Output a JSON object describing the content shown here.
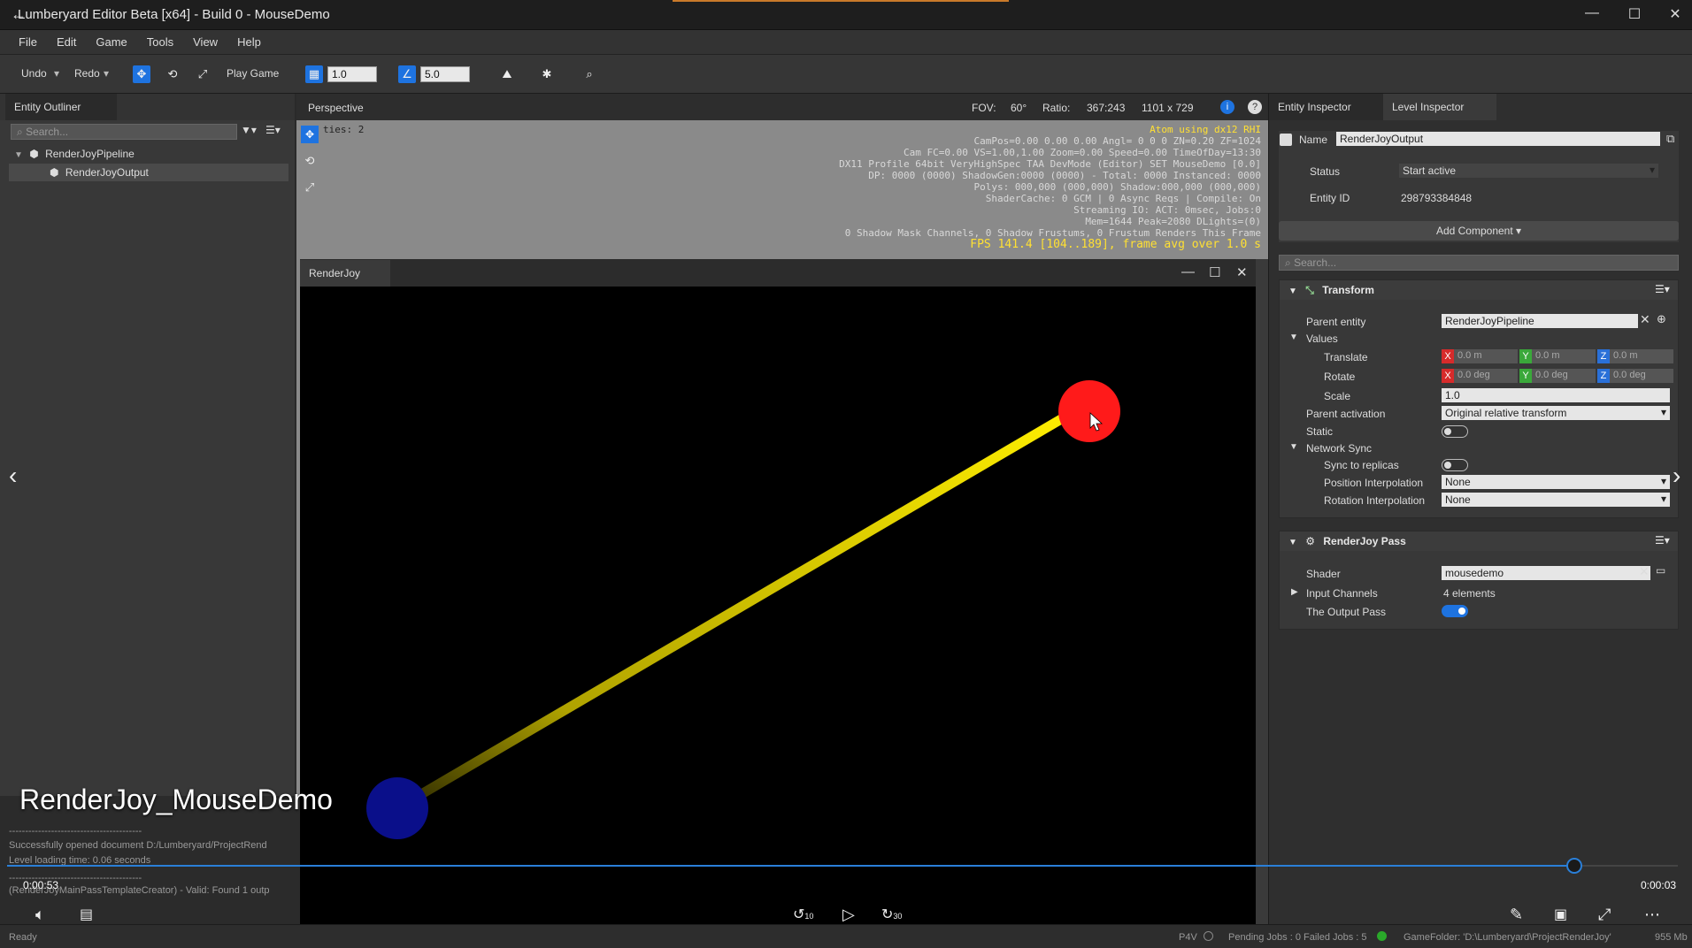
{
  "window": {
    "title": "Lumberyard Editor Beta [x64] - Build 0 - MouseDemo",
    "back_icon": "back-arrow-icon",
    "minimize": "—",
    "maximize": "☐",
    "close": "✕"
  },
  "menu": [
    "File",
    "Edit",
    "Game",
    "Tools",
    "View",
    "Help"
  ],
  "toolbar": {
    "undo": "Undo",
    "redo": "Redo",
    "play_game": "Play Game",
    "grid_value": "1.0",
    "angle_value": "5.0"
  },
  "outliner": {
    "tab": "Entity Outliner",
    "search_placeholder": "Search...",
    "items": [
      {
        "label": "RenderJoyPipeline"
      },
      {
        "label": "RenderJoyOutput"
      }
    ]
  },
  "viewport": {
    "tab": "Perspective",
    "fov_label": "FOV:",
    "fov_value": "60°",
    "ratio_label": "Ratio:",
    "ratio_value": "367:243",
    "resolution": "1101 x 729",
    "entities_text": "ties: 2",
    "debug_lines": [
      "Atom using dx12 RHI",
      "CamPos=0.00 0.00 0.00 Angl=  0  0   0 ZN=0.20 ZF=1024",
      "Cam FC=0.00 VS=1.00,1.00 Zoom=0.00 Speed=0.00 TimeOfDay=13:30",
      "DX11 Profile 64bit VeryHighSpec TAA DevMode (Editor) SET MouseDemo [0.0]",
      "DP: 0000 (0000) ShadowGen:0000 (0000) - Total: 0000 Instanced: 0000",
      "Polys: 000,000 (000,000) Shadow:000,000 (000,000)",
      "ShaderCache: 0 GCM | 0 Async Reqs | Compile: On",
      "Streaming IO: ACT:    0msec, Jobs:0",
      "Mem=1644 Peak=2080 DLights=(0)",
      "0 Shadow Mask Channels,   0 Shadow Frustums,   0 Frustum Renders This Frame",
      "FPS 141.4 [104..189], frame avg over 1.0 s"
    ]
  },
  "renderjoy": {
    "tab": "RenderJoy",
    "colors": {
      "line": "#f2e000",
      "red_ball": "#ff1a1a",
      "blue_ball": "#0a0f8a"
    }
  },
  "inspector": {
    "tabs": [
      "Entity Inspector",
      "Level Inspector"
    ],
    "name_label": "Name",
    "name_value": "RenderJoyOutput",
    "status_label": "Status",
    "status_value": "Start active",
    "entity_id_label": "Entity ID",
    "entity_id_value": "298793384848",
    "add_component": "Add Component ▾",
    "search_placeholder": "Search...",
    "transform": {
      "title": "Transform",
      "parent_entity_label": "Parent entity",
      "parent_entity_value": "RenderJoyPipeline",
      "values_label": "Values",
      "translate_label": "Translate",
      "translate": [
        "0.0 m",
        "0.0 m",
        "0.0 m"
      ],
      "rotate_label": "Rotate",
      "rotate": [
        "0.0 deg",
        "0.0 deg",
        "0.0 deg"
      ],
      "scale_label": "Scale",
      "scale_value": "1.0",
      "parent_activation_label": "Parent activation",
      "parent_activation_value": "Original relative transform",
      "static_label": "Static",
      "network_sync_label": "Network Sync",
      "sync_label": "Sync to replicas",
      "pos_interp_label": "Position Interpolation",
      "pos_interp_value": "None",
      "rot_interp_label": "Rotation Interpolation",
      "rot_interp_value": "None"
    },
    "renderjoy_pass": {
      "title": "RenderJoy Pass",
      "shader_label": "Shader",
      "shader_value": "mousedemo",
      "input_channels_label": "Input Channels",
      "input_channels_value": "4 elements",
      "output_pass_label": "The Output Pass"
    }
  },
  "console": {
    "lines": [
      "-----------------------------------------",
      "Successfully opened document D:/Lumberyard/ProjectRend",
      "Level loading time: 0.06 seconds",
      "-----------------------------------------",
      "(RenderJoyMainPassTemplateCreator) - Valid: Found 1 outp"
    ]
  },
  "video": {
    "title": "RenderJoy_MouseDemo",
    "elapsed": "0:00:53",
    "remaining": "0:00:03",
    "skip_back": "10",
    "skip_fwd": "30",
    "progress": 0.938
  },
  "status": {
    "ready": "Ready",
    "p4v": "P4V",
    "jobs": "Pending Jobs : 0  Failed Jobs : 5",
    "gamefolder": "GameFolder: 'D:\\Lumberyard\\ProjectRenderJoy'",
    "mem": "955 Mb"
  }
}
